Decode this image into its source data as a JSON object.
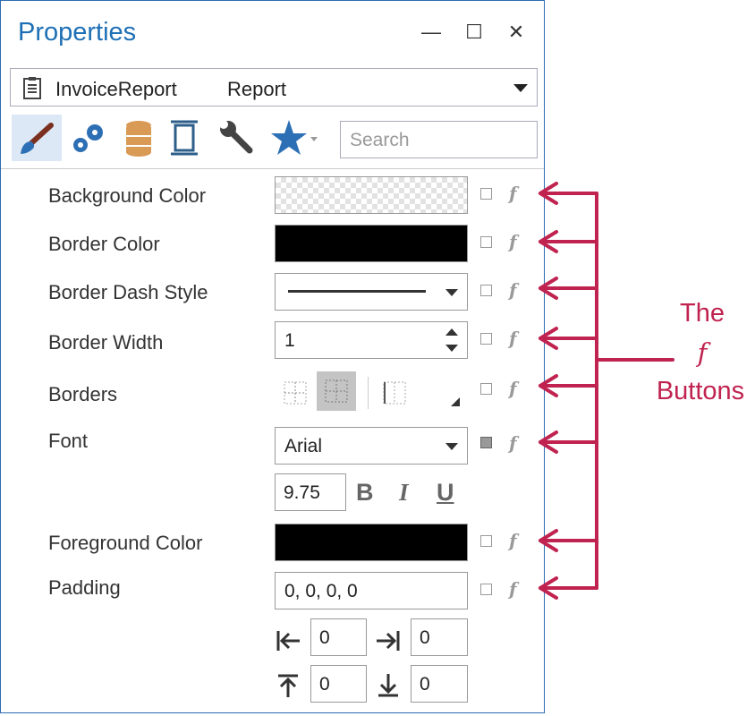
{
  "window": {
    "title": "Properties",
    "minimize": "—",
    "maximize": "☐",
    "close": "✕"
  },
  "object_selector": {
    "name": "InvoiceReport",
    "type": "Report"
  },
  "toolbar": {
    "search_placeholder": "Search"
  },
  "properties": {
    "background_color": {
      "label": "Background Color"
    },
    "border_color": {
      "label": "Border Color",
      "color": "#000000"
    },
    "border_dash_style": {
      "label": "Border Dash Style"
    },
    "border_width": {
      "label": "Border Width",
      "value": "1"
    },
    "borders": {
      "label": "Borders"
    },
    "font": {
      "label": "Font",
      "family": "Arial",
      "size": "9.75",
      "bold": "B",
      "italic": "I",
      "underline": "U"
    },
    "foreground_color": {
      "label": "Foreground Color",
      "color": "#000000"
    },
    "padding": {
      "label": "Padding",
      "value": "0, 0, 0, 0",
      "left": "0",
      "right": "0",
      "top": "0",
      "bottom": "0"
    }
  },
  "f_button": "f",
  "annotation": {
    "line1": "The",
    "line2": "f",
    "line3": "Buttons",
    "color": "#c0234f"
  }
}
